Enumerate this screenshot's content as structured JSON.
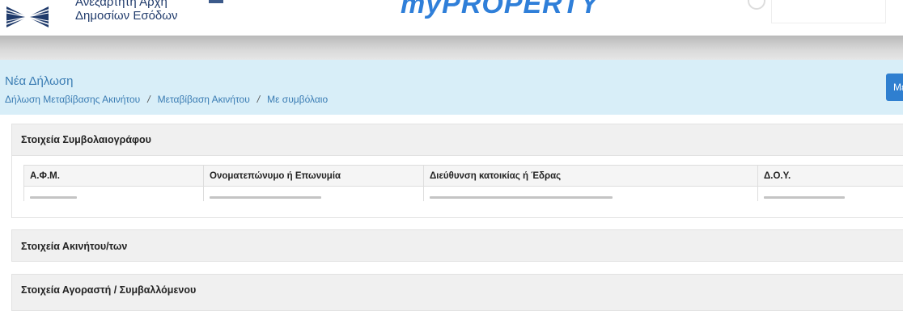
{
  "header": {
    "org_line1": "Ανεξάρτητη Αρχή",
    "org_line2": "Δημοσίων Εσόδων",
    "brand": "myPROPERTY",
    "brand_color": "#2f7fd9"
  },
  "page": {
    "title": "Νέα Δήλωση",
    "breadcrumb": [
      "Δήλωση Μεταβίβασης Ακινήτου",
      "Μεταβίβαση Ακινήτου",
      "Με συμβόλαιο"
    ],
    "breadcrumb_sep": "/",
    "action_button": "Με"
  },
  "panels": {
    "notary": {
      "title": "Στοιχεία Συμβολαιογράφου",
      "columns": [
        "Α.Φ.Μ.",
        "Ονοματεπώνυμο ή Επωνυμία",
        "Διεύθυνση κατοικίας ή Έδρας",
        "Δ.Ο.Υ."
      ]
    },
    "properties": {
      "title": "Στοιχεία Ακινήτου/των"
    },
    "buyer": {
      "title": "Στοιχεία Αγοραστή / Συμβαλλόμενου"
    }
  }
}
